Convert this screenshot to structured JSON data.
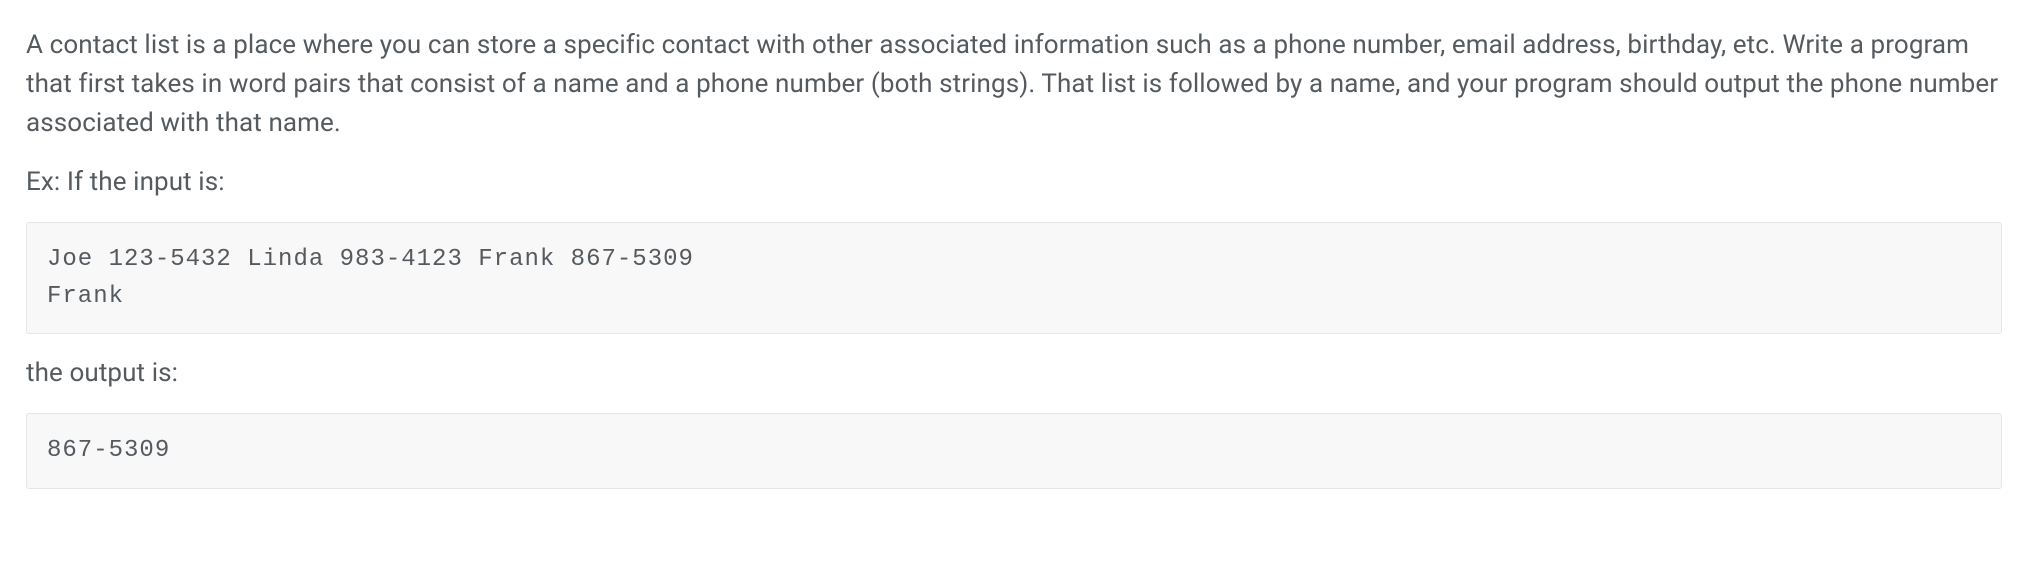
{
  "paragraphs": {
    "intro": "A contact list is a place where you can store a specific contact with other associated information such as a phone number, email address, birthday, etc. Write a program that first takes in word pairs that consist of a name and a phone number (both strings). That list is followed by a name, and your program should output the phone number associated with that name.",
    "example_label": "Ex: If the input is:",
    "output_label": "the output is:"
  },
  "code_blocks": {
    "input_example": "Joe 123-5432 Linda 983-4123 Frank 867-5309\nFrank",
    "output_example": "867-5309"
  }
}
